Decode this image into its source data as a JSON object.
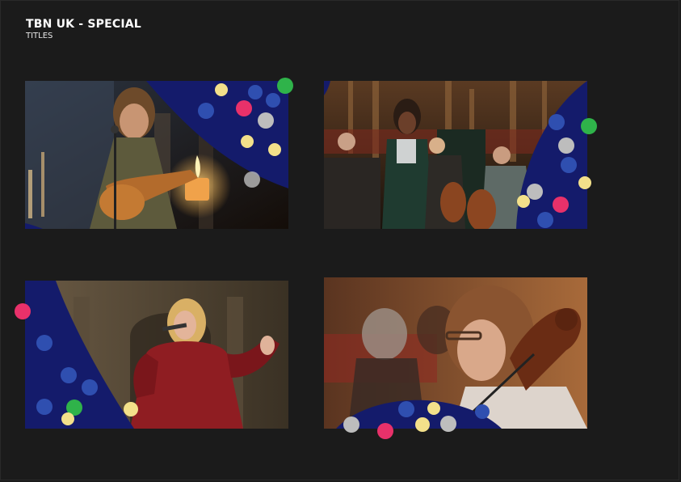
{
  "header": {
    "title": "TBN UK - SPECIAL",
    "subtitle": "TITLES"
  },
  "colors": {
    "background": "#1b1b1b",
    "overlay_blue": "#141b6b",
    "dot_pink": "#e8316a",
    "dot_green": "#2fb34a",
    "dot_yellow": "#f3e08a",
    "dot_blue": "#2f4fb0",
    "dot_grey": "#bdbdbd"
  },
  "frames": [
    {
      "subject": "guitarist-singer-with-candles"
    },
    {
      "subject": "singer-with-string-orchestra"
    },
    {
      "subject": "singer-in-red-coat"
    },
    {
      "subject": "cellist-closeup"
    }
  ]
}
